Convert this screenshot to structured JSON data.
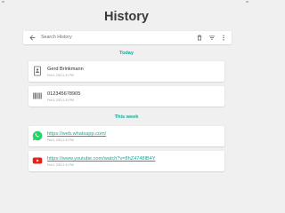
{
  "header": {
    "title": "History"
  },
  "search": {
    "placeholder": "Search History"
  },
  "toolbar": {
    "back_icon": "arrow-back-icon",
    "delete_icon": "trash-icon",
    "sort_icon": "sort-icon",
    "more_icon": "more-vert-icon"
  },
  "sections": [
    {
      "header": "Today",
      "items": [
        {
          "icon": "contact-card-icon",
          "title": "Gerd Brinkmann",
          "date": "Feb 4, 2021 1:31 PM",
          "is_link": false
        },
        {
          "icon": "barcode-icon",
          "title": "012345678905",
          "date": "Feb 4, 2021 1:31 PM",
          "is_link": false
        }
      ]
    },
    {
      "header": "This week",
      "items": [
        {
          "icon": "whatsapp-icon",
          "title": "https://web.whatsapp.com/",
          "date": "Feb 2, 2021 1:31 PM",
          "is_link": true
        },
        {
          "icon": "youtube-icon",
          "title": "https://www.youtube.com/watch?v=8hZ4748lB4Y",
          "date": "Feb 2, 2021 1:31 PM",
          "is_link": true
        }
      ]
    }
  ],
  "colors": {
    "accent": "#18a89a",
    "background": "#f0f0f0",
    "whatsapp": "#25d366",
    "youtube": "#e62117"
  }
}
